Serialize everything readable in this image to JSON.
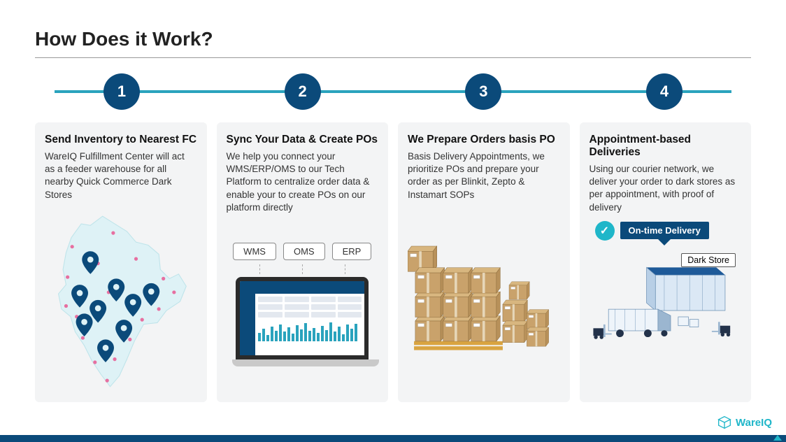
{
  "title": "How Does it Work?",
  "steps": [
    "1",
    "2",
    "3",
    "4"
  ],
  "cards": [
    {
      "heading": "Send Inventory to Nearest FC",
      "body": "WareIQ Fulfillment Center will act as a feeder warehouse for all nearby Quick Commerce Dark Stores"
    },
    {
      "heading": "Sync Your Data & Create POs",
      "body": "We help you connect your WMS/ERP/OMS to our Tech Platform to centralize order data & enable your to create POs on our platform directly",
      "tags": [
        "WMS",
        "OMS",
        "ERP"
      ]
    },
    {
      "heading": "We Prepare Orders basis PO",
      "body": "Basis Delivery Appointments, we prioritize POs and prepare your order as per Blinkit, Zepto & Instamart SOPs"
    },
    {
      "heading": "Appointment-based Deliveries",
      "body": "Using our courier network, we deliver your order to dark stores as per appointment, with proof of delivery",
      "flag": "On-time Delivery",
      "darkstore": "Dark Store"
    }
  ],
  "brand": "WareIQ"
}
